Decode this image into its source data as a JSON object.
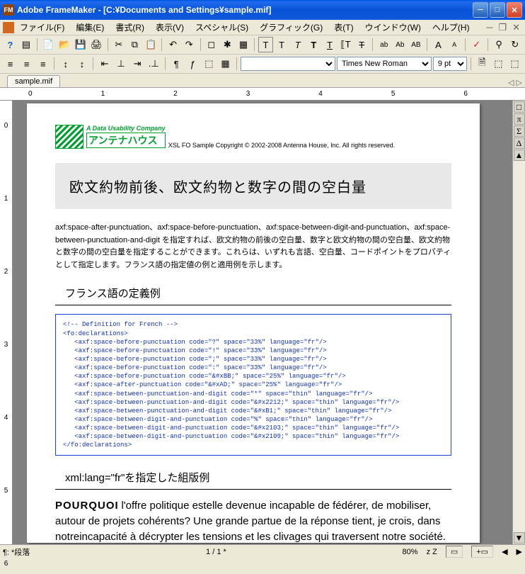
{
  "window": {
    "app": "FM",
    "title": "Adobe FrameMaker - [C:¥Documents and Settings¥sample.mif]"
  },
  "menu": {
    "file": "ファイル(F)",
    "edit": "編集(E)",
    "format": "書式(R)",
    "view": "表示(V)",
    "special": "スペシャル(S)",
    "graphic": "グラフィック(G)",
    "table": "表(T)",
    "window": "ウインドウ(W)",
    "help": "ヘルプ(H)"
  },
  "toolbar2": {
    "style_combo": "",
    "font_combo": "Times New Roman",
    "size_combo": "9 pt"
  },
  "tab": {
    "label": "sample.mif"
  },
  "ruler_h": [
    "0",
    "1",
    "2",
    "3",
    "4",
    "5",
    "6"
  ],
  "ruler_v": [
    "0",
    "1",
    "2",
    "3",
    "4",
    "5",
    "6"
  ],
  "document": {
    "logo_line1": "A Data Usability Company",
    "logo_line2": "アンテナハウス",
    "copyright": "XSL FO Sample Copyright © 2002-2008 Antenna House, Inc. All rights reserved.",
    "heading": "欧文約物前後、欧文約物と数字の間の空白量",
    "description": "axf:space-after-punctuation、axf:space-before-punctuation、axf:space-between-digit-and-punctuation、axf:space-between-punctuation-and-digit を指定すれば、欧文約物の前後の空白量、数字と欧文約物の間の空白量、欧文約物と数字の間の空白量を指定することができます。これらは、いずれも言語、空白量、コードポイントをプロパティとして指定します。フランス語の指定値の例と適用例を示します。",
    "section1": "フランス語の定義例",
    "code": "<!-- Definition for French -->\n<fo:declarations>\n   <axf:space-before-punctuation code=\"?\" space=\"33%\" language=\"fr\"/>\n   <axf:space-before-punctuation code=\"!\" space=\"33%\" language=\"fr\"/>\n   <axf:space-before-punctuation code=\";\" space=\"33%\" language=\"fr\"/>\n   <axf:space-before-punctuation code=\":\" space=\"33%\" language=\"fr\"/>\n   <axf:space-before-punctuation code=\"&#xBB;\" space=\"25%\" language=\"fr\"/>\n   <axf:space-after-punctuation code=\"&#xAD;\" space=\"25%\" language=\"fr\"/>\n   <axf:space-between-punctuation-and-digit code=\"*\" space=\"thin\" language=\"fr\"/>\n   <axf:space-between-punctuation-and-digit code=\"&#x2212;\" space=\"thin\" language=\"fr\"/>\n   <axf:space-between-punctuation-and-digit code=\"&#xB1;\" space=\"thin\" language=\"fr\"/>\n   <axf:space-between-digit-and-punctuation code=\"%\" space=\"thin\" language=\"fr\"/>\n   <axf:space-between-digit-and-punctuation code=\"&#x2103;\" space=\"thin\" language=\"fr\"/>\n   <axf:space-between-digit-and-punctuation code=\"&#x2109;\" space=\"thin\" language=\"fr\"/>\n</fo:declarations>",
    "section2": "xml:lang=\"fr\"を指定した組版例",
    "body_lead": "POURQUOI",
    "body": "l'offre politique estelle devenue incapable de fédérer, de mobiliser, autour de projets cohérents? Une grande partue de la réponse tient, je crois, dans notreincapacité à décrypter les tensions et les clivages qui traversent notre société. Nous restons prisonniers d'une vision binaire, fondamentalement incomplète: «société de classes» contre «société des individus»."
  },
  "statusbar": {
    "flow": "¶: *段落",
    "page": "1 / 1 *",
    "zoom": "80%",
    "zz": "z Z"
  }
}
